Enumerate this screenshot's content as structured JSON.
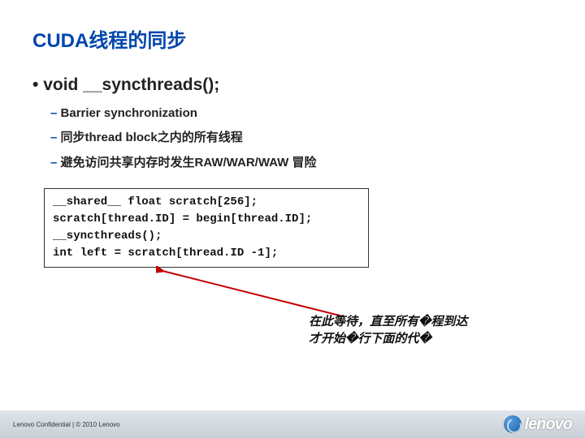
{
  "title": "CUDA线程的同步",
  "main_bullet": "void __syncthreads();",
  "sub_items": [
    "Barrier synchronization",
    "同步thread block之内的所有线程",
    "避免访问共享内存时发生RAW/WAR/WAW 冒险"
  ],
  "dash": "– ",
  "code_lines": [
    "__shared__ float scratch[256];",
    "scratch[thread.ID] = begin[thread.ID];",
    "__syncthreads();",
    "int left = scratch[thread.ID -1];"
  ],
  "caption_line1": "在此等待，直至所有�程到达",
  "caption_line2": "才开始�行下面的代�",
  "footer_text": "Lenovo Confidential | © 2010 Lenovo",
  "logo_text": "lenovo"
}
